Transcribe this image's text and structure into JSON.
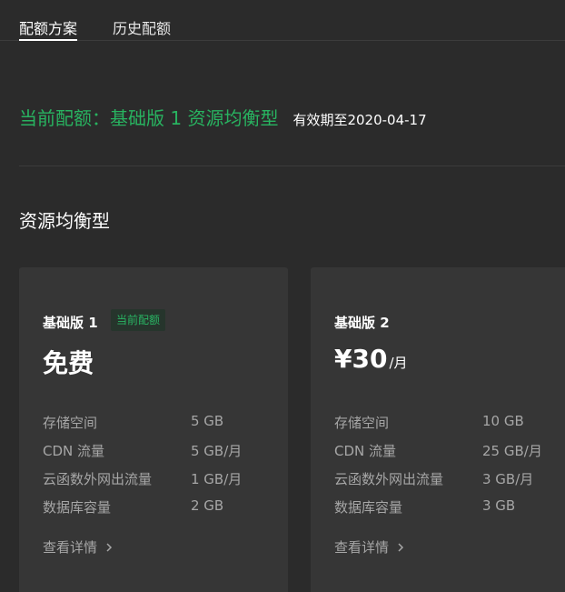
{
  "tabs": [
    {
      "label": "配额方案",
      "active": true
    },
    {
      "label": "历史配额",
      "active": false
    }
  ],
  "current": {
    "plan_text": "当前配额：基础版 1 资源均衡型",
    "expiry_text": "有效期至2020-04-17"
  },
  "section": {
    "title": "资源均衡型"
  },
  "plans": [
    {
      "name": "基础版 1",
      "badge": "当前配额",
      "price": "免费",
      "unit": "",
      "specs": [
        {
          "label": "存储空间",
          "value": "5 GB"
        },
        {
          "label": "CDN 流量",
          "value": "5 GB/月"
        },
        {
          "label": "云函数外网出流量",
          "value": "1 GB/月"
        },
        {
          "label": "数据库容量",
          "value": "2 GB"
        }
      ],
      "details_label": "查看详情"
    },
    {
      "name": "基础版 2",
      "price": "¥30",
      "unit": "/月",
      "specs": [
        {
          "label": "存储空间",
          "value": "10 GB"
        },
        {
          "label": "CDN 流量",
          "value": "25 GB/月"
        },
        {
          "label": "云函数外网出流量",
          "value": "3 GB/月"
        },
        {
          "label": "数据库容量",
          "value": "3 GB"
        }
      ],
      "details_label": "查看详情"
    }
  ],
  "colors": {
    "background": "#2b2b2b",
    "card": "#363636",
    "accent_green": "#28b360",
    "muted_text": "#a6a6a6"
  },
  "icons": {
    "details_chevron": "chevron-right-icon"
  }
}
